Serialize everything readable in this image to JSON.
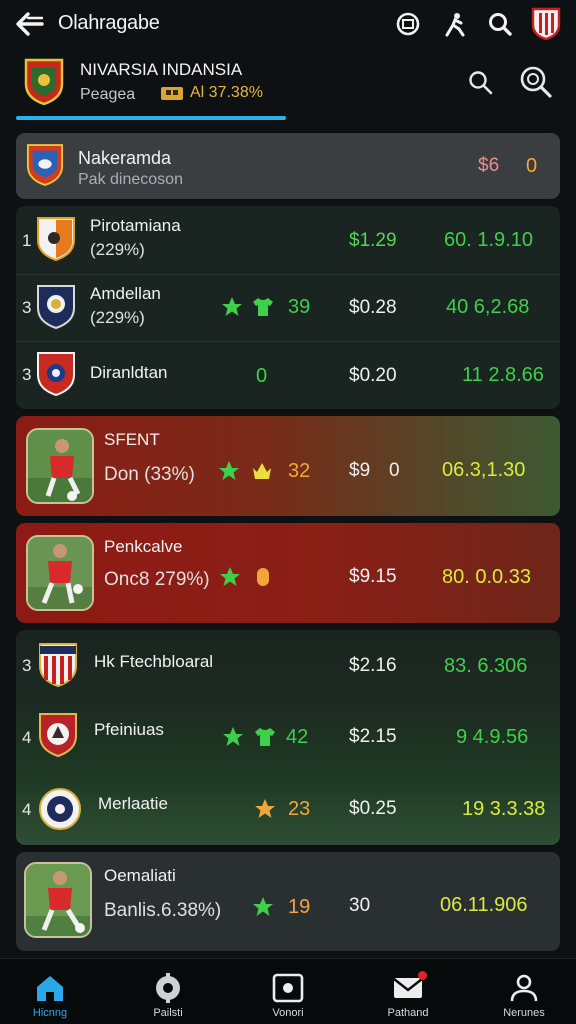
{
  "header": {
    "title": "Olahragabe"
  },
  "league": {
    "name": "NIVARSIA INDANSIA",
    "sub_label": "Peagea",
    "badge": "Al 37.38%"
  },
  "featured": {
    "name": "Nakeramda",
    "subtitle": "Pak dinecoson",
    "price": "$6",
    "count": "0"
  },
  "group1": [
    {
      "rank": "1",
      "name": "Pirotamiana",
      "sub": "(229%)",
      "price": "$1.29",
      "value": "60. 1.9.10"
    },
    {
      "rank": "3",
      "name": "Amdellan",
      "sub": "(229%)",
      "stat": "39",
      "price": "$0.28",
      "value": "40  6,2.68"
    },
    {
      "rank": "3",
      "name": "Diranldtan",
      "stat": "0",
      "price": "$0.20",
      "value": "11  2.8.66"
    }
  ],
  "player1": {
    "name": "SFENT",
    "sub": "Don (33%)",
    "stat": "32",
    "price": "$9",
    "extra": "0",
    "value": "06.3,1.30"
  },
  "player2": {
    "name": "Penkcalve",
    "sub": "Onc8 279%)",
    "price": "$9.15",
    "value": "80. 0.0.33"
  },
  "group2": [
    {
      "rank": "3",
      "name": "Hk Ftechbloaral",
      "price": "$2.16",
      "value": "83. 6.306"
    },
    {
      "rank": "4",
      "name": "Pfeiniuas",
      "stat": "42",
      "price": "$2.15",
      "value": "9  4.9.56"
    },
    {
      "rank": "4",
      "name": "Merlaatie",
      "stat": "23",
      "price": "$0.25",
      "value": "19  3.3.38"
    }
  ],
  "player3": {
    "name": "Oemaliati",
    "sub": "Banlis.6.38%)",
    "stat": "19",
    "price": "30",
    "value": "06.11.906"
  },
  "nav": [
    {
      "label": "Hicnng"
    },
    {
      "label": "Pailsti"
    },
    {
      "label": "Vonori"
    },
    {
      "label": "Pathand"
    },
    {
      "label": "Nerunes"
    }
  ],
  "colors": {
    "accent": "#2bb3e6",
    "positive": "#3ed04a",
    "highlight": "#dcea3c",
    "warning": "#f2a63a",
    "alert": "#e52222"
  }
}
